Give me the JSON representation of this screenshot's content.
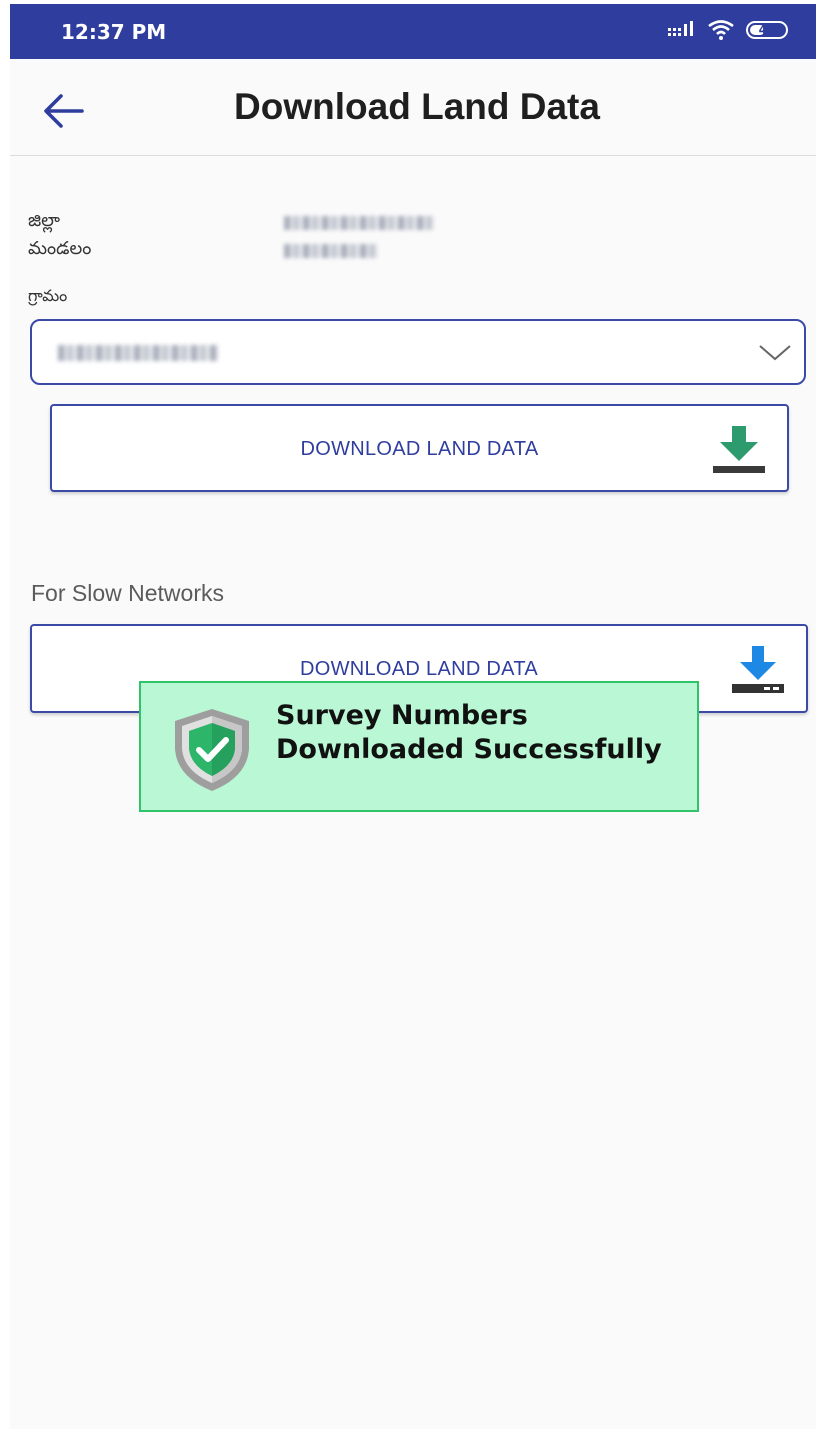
{
  "status_bar": {
    "time": "12:37 PM",
    "battery_level": "44",
    "battery_fraction": 0.44
  },
  "app_bar": {
    "title": "Download Land Data",
    "back_icon": "arrow-left-icon"
  },
  "location": {
    "district_label": "జిల్లా",
    "mandal_label": "మండలం",
    "village_label": "గ్రామం"
  },
  "village_select": {
    "chevron_icon": "chevron-down-icon"
  },
  "download_button": {
    "label": "DOWNLOAD LAND DATA",
    "icon": "download-icon",
    "icon_color": "#2e9b6e"
  },
  "slow_network": {
    "section_label": "For Slow Networks",
    "button_label": "DOWNLOAD LAND DATA",
    "icon": "download-icon",
    "icon_color": "#1e88e5"
  },
  "toast": {
    "message": "Survey Numbers Downloaded Successfully",
    "icon": "shield-check-icon"
  },
  "colors": {
    "primary": "#2f3e9e",
    "background": "#fafafa",
    "toast_background": "#b9f7d5",
    "toast_border": "#2fc46a"
  }
}
